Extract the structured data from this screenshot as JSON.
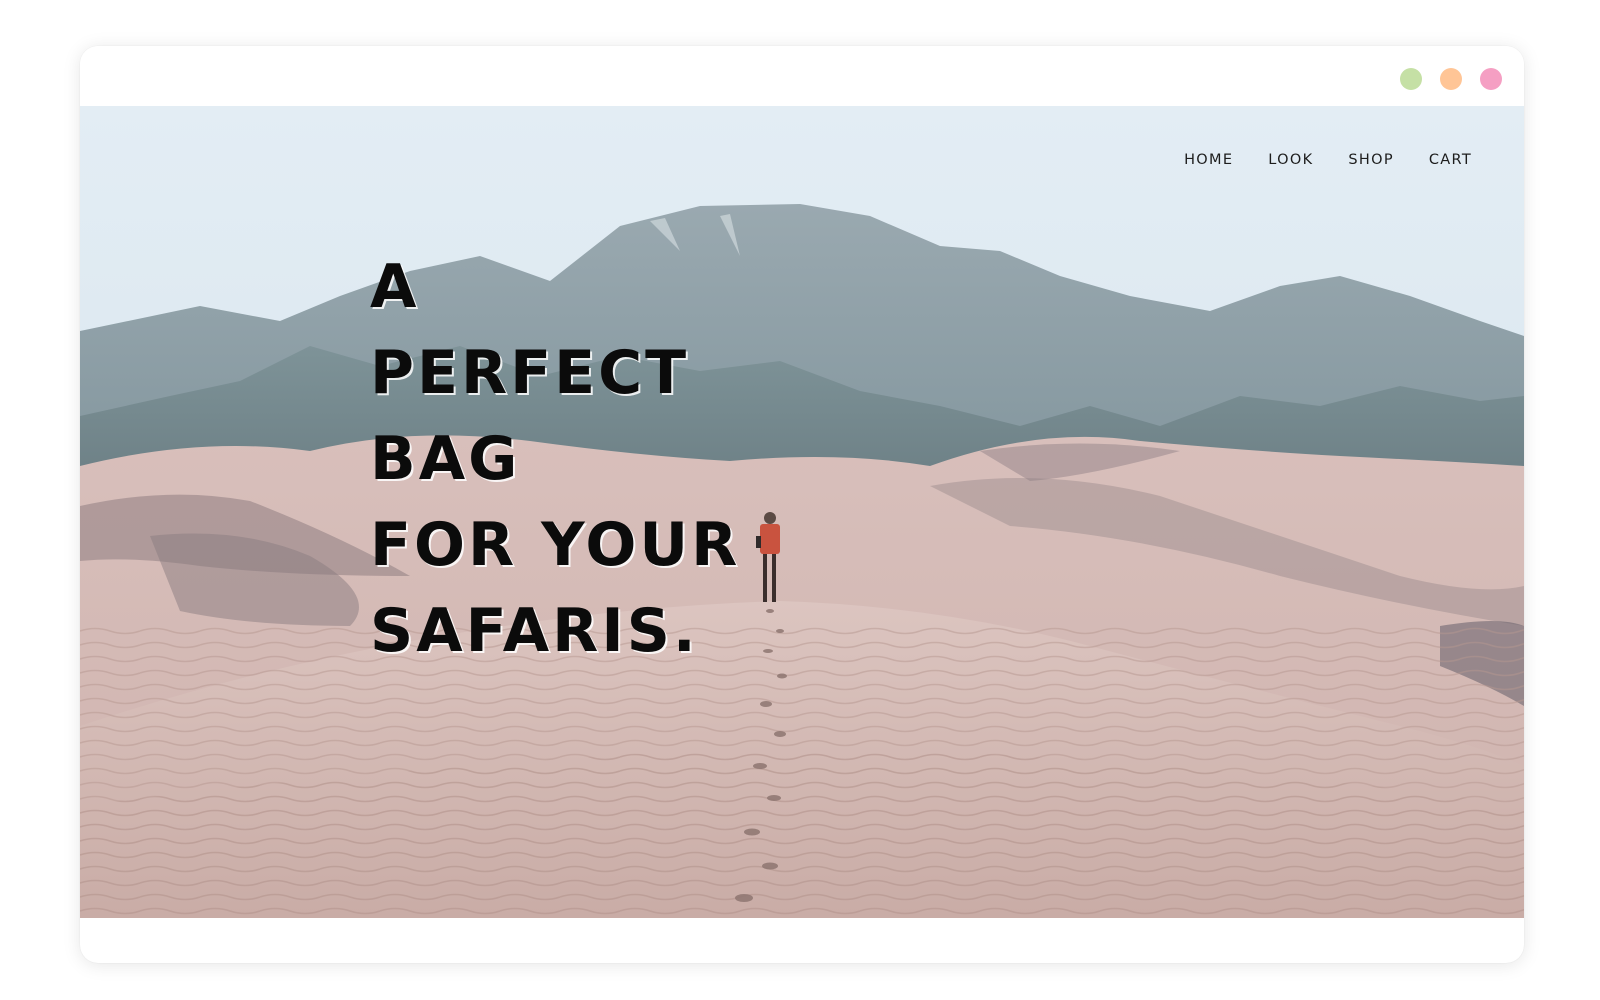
{
  "window": {
    "controls": [
      {
        "name": "green",
        "color": "#c5e0a5"
      },
      {
        "name": "orange",
        "color": "#ffc596"
      },
      {
        "name": "pink",
        "color": "#f59fc3"
      }
    ]
  },
  "nav": {
    "items": [
      {
        "label": "HOME"
      },
      {
        "label": "LOOK"
      },
      {
        "label": "SHOP"
      },
      {
        "label": "CART"
      }
    ]
  },
  "hero": {
    "headline_lines": [
      "A",
      "PERFECT",
      "BAG",
      "FOR YOUR",
      "SAFARIS."
    ],
    "image": "desert-dunes-mountains-hiker-photo"
  }
}
